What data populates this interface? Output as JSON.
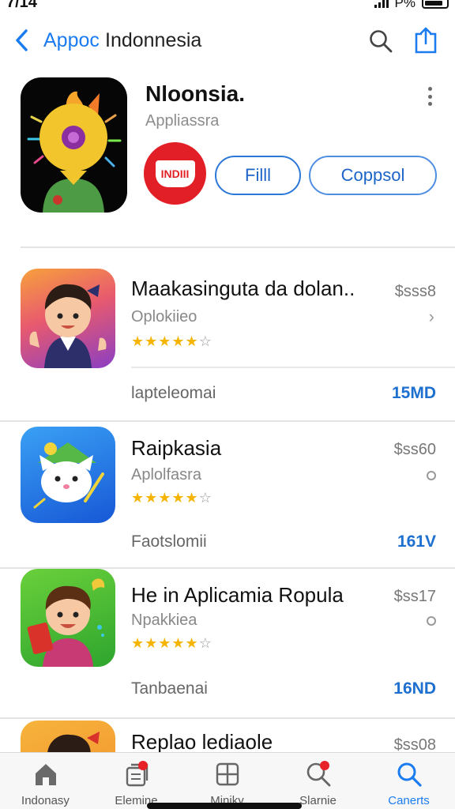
{
  "status_bar": {
    "time": "7/14",
    "battery_text": "P%"
  },
  "nav": {
    "back_label": "Appoс",
    "title": "Indonnesia"
  },
  "hero_app": {
    "name": "Nloonsia.",
    "subtitle": "Appliassra",
    "badge_text": "INDIII",
    "get_label": "Filll",
    "open_label": "Coppsol"
  },
  "apps": [
    {
      "title": "Maakasinguta da dolan..",
      "subtitle": "Oplokiieo",
      "price": "$ѕѕѕ8",
      "rating": 4,
      "meta_label": "lapteleomai",
      "meta_value": "15MD",
      "trailing": "chevron"
    },
    {
      "title": "Raipkasia",
      "subtitle": "Aplolfasra",
      "price": "$ѕѕ60",
      "rating": 4,
      "meta_label": "Faotslomii",
      "meta_value": "161V",
      "trailing": "dot"
    },
    {
      "title": "He in Aplicamia Ropula",
      "subtitle": "Npakkiea",
      "price": "$ѕѕ17",
      "rating": 4,
      "meta_label": "Tanbaenai",
      "meta_value": "16ND",
      "trailing": "dot"
    },
    {
      "title": "Replao lediaole",
      "price": "$ѕѕ08"
    }
  ],
  "tabs": [
    {
      "label": "Indonasy",
      "icon": "home-icon",
      "badge": false
    },
    {
      "label": "Elemine",
      "icon": "stack-icon",
      "badge": true
    },
    {
      "label": "Miniky",
      "icon": "grid-icon",
      "badge": false
    },
    {
      "label": "Slarnie",
      "icon": "search-icon",
      "badge": true
    },
    {
      "label": "Canerts",
      "icon": "search-icon",
      "badge": false,
      "active": true
    }
  ],
  "colors": {
    "accent": "#1a7cf0",
    "badge_red": "#e21f26",
    "star": "#f5b400"
  }
}
